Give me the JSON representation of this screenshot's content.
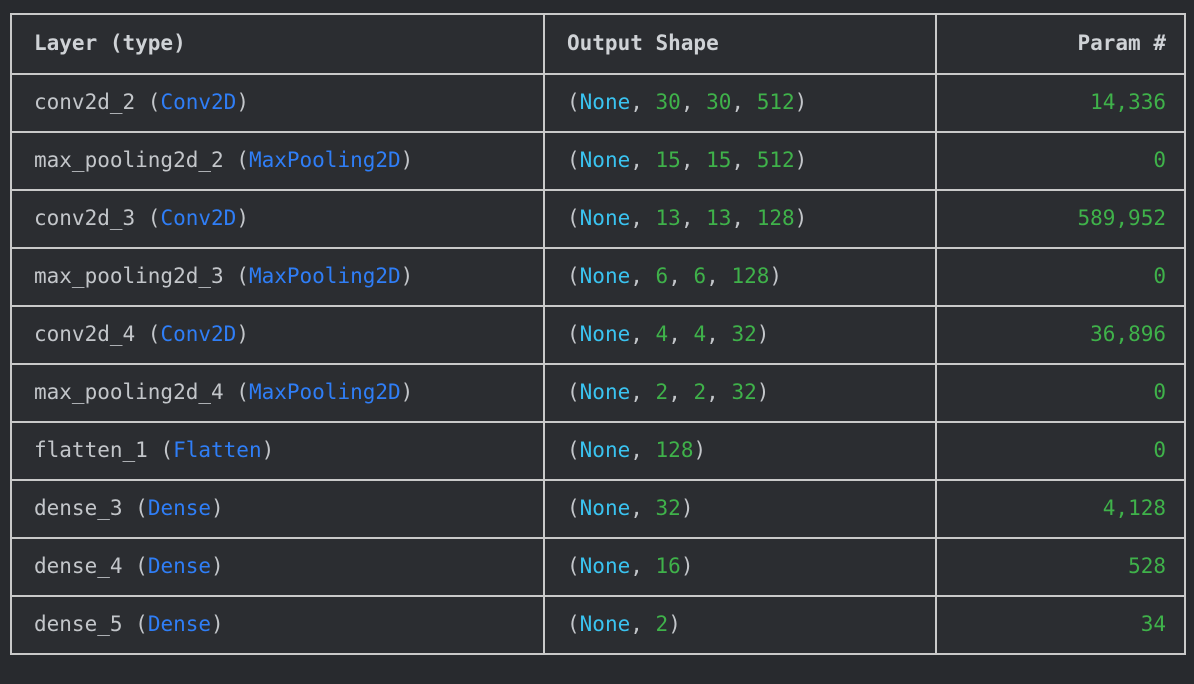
{
  "colors": {
    "page_background": "#282a2e",
    "cell_background": "#2b2d31",
    "border": "#c9c9c9",
    "header_text": "#cfd2d6",
    "plain_text": "#c3c6ca",
    "class_name_blue": "#2f7ef7",
    "none_cyan": "#3ac3f0",
    "number_green": "#3fb24a"
  },
  "table": {
    "headers": [
      {
        "label": "Layer (type)",
        "align": "left"
      },
      {
        "label": "Output Shape",
        "align": "left"
      },
      {
        "label": "Param #",
        "align": "right"
      }
    ],
    "rows": [
      {
        "layer_name": "conv2d_2",
        "layer_class": "Conv2D",
        "output_shape": [
          "None",
          "30",
          "30",
          "512"
        ],
        "params": "14,336"
      },
      {
        "layer_name": "max_pooling2d_2",
        "layer_class": "MaxPooling2D",
        "output_shape": [
          "None",
          "15",
          "15",
          "512"
        ],
        "params": "0"
      },
      {
        "layer_name": "conv2d_3",
        "layer_class": "Conv2D",
        "output_shape": [
          "None",
          "13",
          "13",
          "128"
        ],
        "params": "589,952"
      },
      {
        "layer_name": "max_pooling2d_3",
        "layer_class": "MaxPooling2D",
        "output_shape": [
          "None",
          "6",
          "6",
          "128"
        ],
        "params": "0"
      },
      {
        "layer_name": "conv2d_4",
        "layer_class": "Conv2D",
        "output_shape": [
          "None",
          "4",
          "4",
          "32"
        ],
        "params": "36,896"
      },
      {
        "layer_name": "max_pooling2d_4",
        "layer_class": "MaxPooling2D",
        "output_shape": [
          "None",
          "2",
          "2",
          "32"
        ],
        "params": "0"
      },
      {
        "layer_name": "flatten_1",
        "layer_class": "Flatten",
        "output_shape": [
          "None",
          "128"
        ],
        "params": "0"
      },
      {
        "layer_name": "dense_3",
        "layer_class": "Dense",
        "output_shape": [
          "None",
          "32"
        ],
        "params": "4,128"
      },
      {
        "layer_name": "dense_4",
        "layer_class": "Dense",
        "output_shape": [
          "None",
          "16"
        ],
        "params": "528"
      },
      {
        "layer_name": "dense_5",
        "layer_class": "Dense",
        "output_shape": [
          "None",
          "2"
        ],
        "params": "34"
      }
    ]
  }
}
